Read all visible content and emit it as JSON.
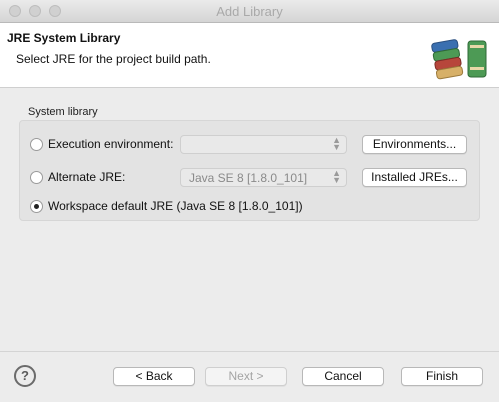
{
  "window": {
    "title": "Add Library"
  },
  "header": {
    "title": "JRE System Library",
    "description": "Select JRE for the project build path."
  },
  "system_library": {
    "label": "System library",
    "options": [
      {
        "label": "Execution environment:",
        "selected": false,
        "combo_value": "",
        "button": "Environments..."
      },
      {
        "label": "Alternate JRE:",
        "selected": false,
        "combo_value": "Java SE 8 [1.8.0_101]",
        "button": "Installed JREs..."
      },
      {
        "label": "Workspace default JRE (Java SE 8 [1.8.0_101])",
        "selected": true
      }
    ]
  },
  "footer": {
    "help_icon": "?",
    "back": "< Back",
    "next": "Next >",
    "cancel": "Cancel",
    "finish": "Finish"
  }
}
